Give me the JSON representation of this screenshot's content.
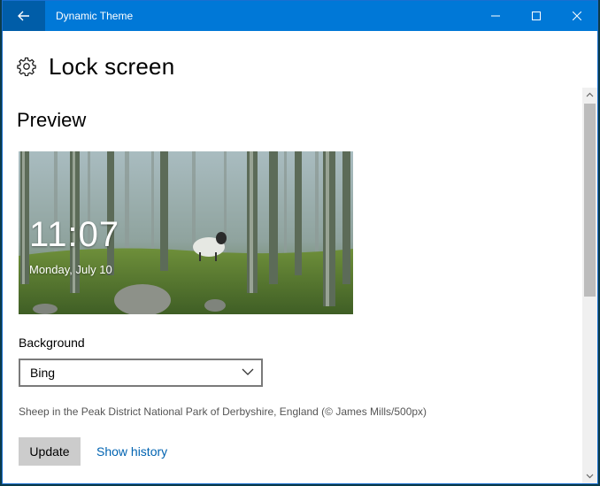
{
  "window": {
    "title": "Dynamic Theme",
    "accent_color": "#0078d7"
  },
  "titlebar": {
    "back_icon": "back-arrow-icon",
    "controls": [
      "minimize-icon",
      "maximize-icon",
      "close-icon"
    ]
  },
  "header": {
    "icon": "gear-icon",
    "title": "Lock screen"
  },
  "preview": {
    "section_title": "Preview",
    "time": "11:07",
    "date": "Monday, July 10"
  },
  "background": {
    "label": "Background",
    "selected": "Bing",
    "caption": "Sheep in the Peak District National Park of Derbyshire, England (© James Mills/500px)"
  },
  "actions": {
    "update_label": "Update",
    "history_label": "Show history",
    "link_color": "#0063b1"
  }
}
